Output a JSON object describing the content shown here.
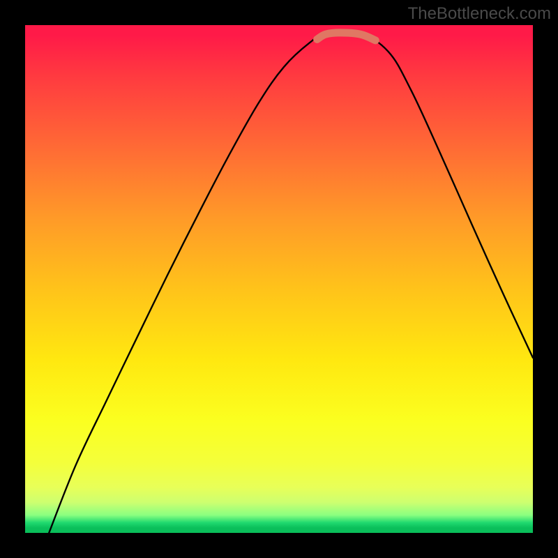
{
  "watermark": "TheBottleneck.com",
  "chart_data": {
    "type": "line",
    "title": "",
    "xlabel": "",
    "ylabel": "",
    "series": [
      {
        "name": "curve",
        "points": [
          {
            "x": 0.047,
            "y": 0.0
          },
          {
            "x": 0.1,
            "y": 0.134
          },
          {
            "x": 0.16,
            "y": 0.26
          },
          {
            "x": 0.22,
            "y": 0.384
          },
          {
            "x": 0.28,
            "y": 0.507
          },
          {
            "x": 0.34,
            "y": 0.626
          },
          {
            "x": 0.4,
            "y": 0.741
          },
          {
            "x": 0.46,
            "y": 0.847
          },
          {
            "x": 0.51,
            "y": 0.918
          },
          {
            "x": 0.56,
            "y": 0.965
          },
          {
            "x": 0.592,
            "y": 0.982
          },
          {
            "x": 0.66,
            "y": 0.982
          },
          {
            "x": 0.715,
            "y": 0.948
          },
          {
            "x": 0.76,
            "y": 0.872
          },
          {
            "x": 0.82,
            "y": 0.742
          },
          {
            "x": 0.88,
            "y": 0.607
          },
          {
            "x": 0.94,
            "y": 0.474
          },
          {
            "x": 1.0,
            "y": 0.345
          }
        ]
      },
      {
        "name": "highlight-segment",
        "color": "#e07763",
        "points": [
          {
            "x": 0.575,
            "y": 0.972
          },
          {
            "x": 0.592,
            "y": 0.982
          },
          {
            "x": 0.62,
            "y": 0.985
          },
          {
            "x": 0.66,
            "y": 0.982
          },
          {
            "x": 0.69,
            "y": 0.97
          }
        ]
      }
    ],
    "xlim": [
      0,
      1
    ],
    "ylim": [
      0,
      1
    ]
  }
}
